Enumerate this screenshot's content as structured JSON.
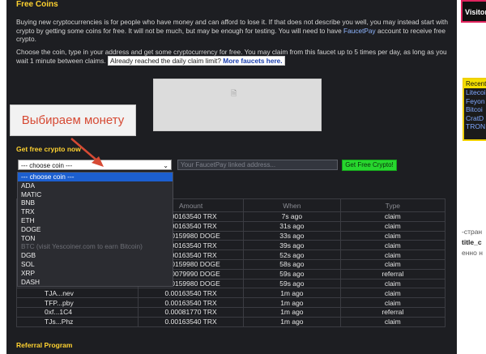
{
  "page": {
    "title": "Free Coins",
    "intro": "Buying new cryptocurrencies is for people who have money and can afford to lose it. If that does not describe you well, you may instead start with crypto by getting some coins for free. It will not be much, but may be enough for testing. You will need to have",
    "faucetpay_link": "FaucetPay",
    "intro_tail": "account to receive free crypto.",
    "instructions": "Choose the coin, type in your address and get some cryptocurrency for free. You may claim from this faucet up to 5 times per day, as long as you wait 1 minute between claims.",
    "limit_note": "Already reached the daily claim limit?",
    "more_faucets": "More faucets here.",
    "callout": "Выбираем монету",
    "get_now": "Get free crypto now",
    "referral": "Referral Program"
  },
  "form": {
    "select_value": "--- choose coin ---",
    "address_placeholder": "Your FaucetPay linked address...",
    "submit_label": "Get Free Crypto!"
  },
  "coin_options": [
    {
      "label": "--- choose coin ---",
      "state": "selected"
    },
    {
      "label": "ADA",
      "state": ""
    },
    {
      "label": "MATIC",
      "state": ""
    },
    {
      "label": "BNB",
      "state": ""
    },
    {
      "label": "TRX",
      "state": ""
    },
    {
      "label": "ETH",
      "state": ""
    },
    {
      "label": "DOGE",
      "state": ""
    },
    {
      "label": "TON",
      "state": ""
    },
    {
      "label": "BTC (visit Yescoiner.com to earn Bitcoin)",
      "state": "disabled"
    },
    {
      "label": "DGB",
      "state": ""
    },
    {
      "label": "SOL",
      "state": ""
    },
    {
      "label": "XRP",
      "state": ""
    },
    {
      "label": "DASH",
      "state": ""
    }
  ],
  "claims_table": {
    "headers": [
      "",
      "Amount",
      "When",
      "Type"
    ],
    "rows": [
      {
        "address": "",
        "amount": "0.00163540 TRX",
        "when": "7s ago",
        "type": "claim"
      },
      {
        "address": "",
        "amount": "0.00163540 TRX",
        "when": "31s ago",
        "type": "claim"
      },
      {
        "address": "",
        "amount": "0.00159980 DOGE",
        "when": "33s ago",
        "type": "claim"
      },
      {
        "address": "",
        "amount": "0.00163540 TRX",
        "when": "39s ago",
        "type": "claim"
      },
      {
        "address": "",
        "amount": "0.00163540 TRX",
        "when": "52s ago",
        "type": "claim"
      },
      {
        "address": "",
        "amount": "0.00159980 DOGE",
        "when": "58s ago",
        "type": "claim"
      },
      {
        "address": "",
        "amount": "0.00079990 DOGE",
        "when": "59s ago",
        "type": "referral"
      },
      {
        "address": "",
        "amount": "0.00159980 DOGE",
        "when": "59s ago",
        "type": "claim"
      },
      {
        "address": "TJA...nev",
        "amount": "0.00163540 TRX",
        "when": "1m ago",
        "type": "claim"
      },
      {
        "address": "TFP...pby",
        "amount": "0.00163540 TRX",
        "when": "1m ago",
        "type": "claim"
      },
      {
        "address": "0xf...1C4",
        "amount": "0.00081770 TRX",
        "when": "1m ago",
        "type": "referral"
      },
      {
        "address": "TJs...Phz",
        "amount": "0.00163540 TRX",
        "when": "1m ago",
        "type": "claim"
      }
    ]
  },
  "sidebar": {
    "visitor_label": "Visitor",
    "recent_header": "Recent",
    "recent_links": [
      "Litecoi",
      "Feyon",
      "Bitcoi",
      "CratD",
      "TRON"
    ],
    "text_1": "-стран",
    "text_2": "title_c",
    "text_3": "енно н"
  }
}
